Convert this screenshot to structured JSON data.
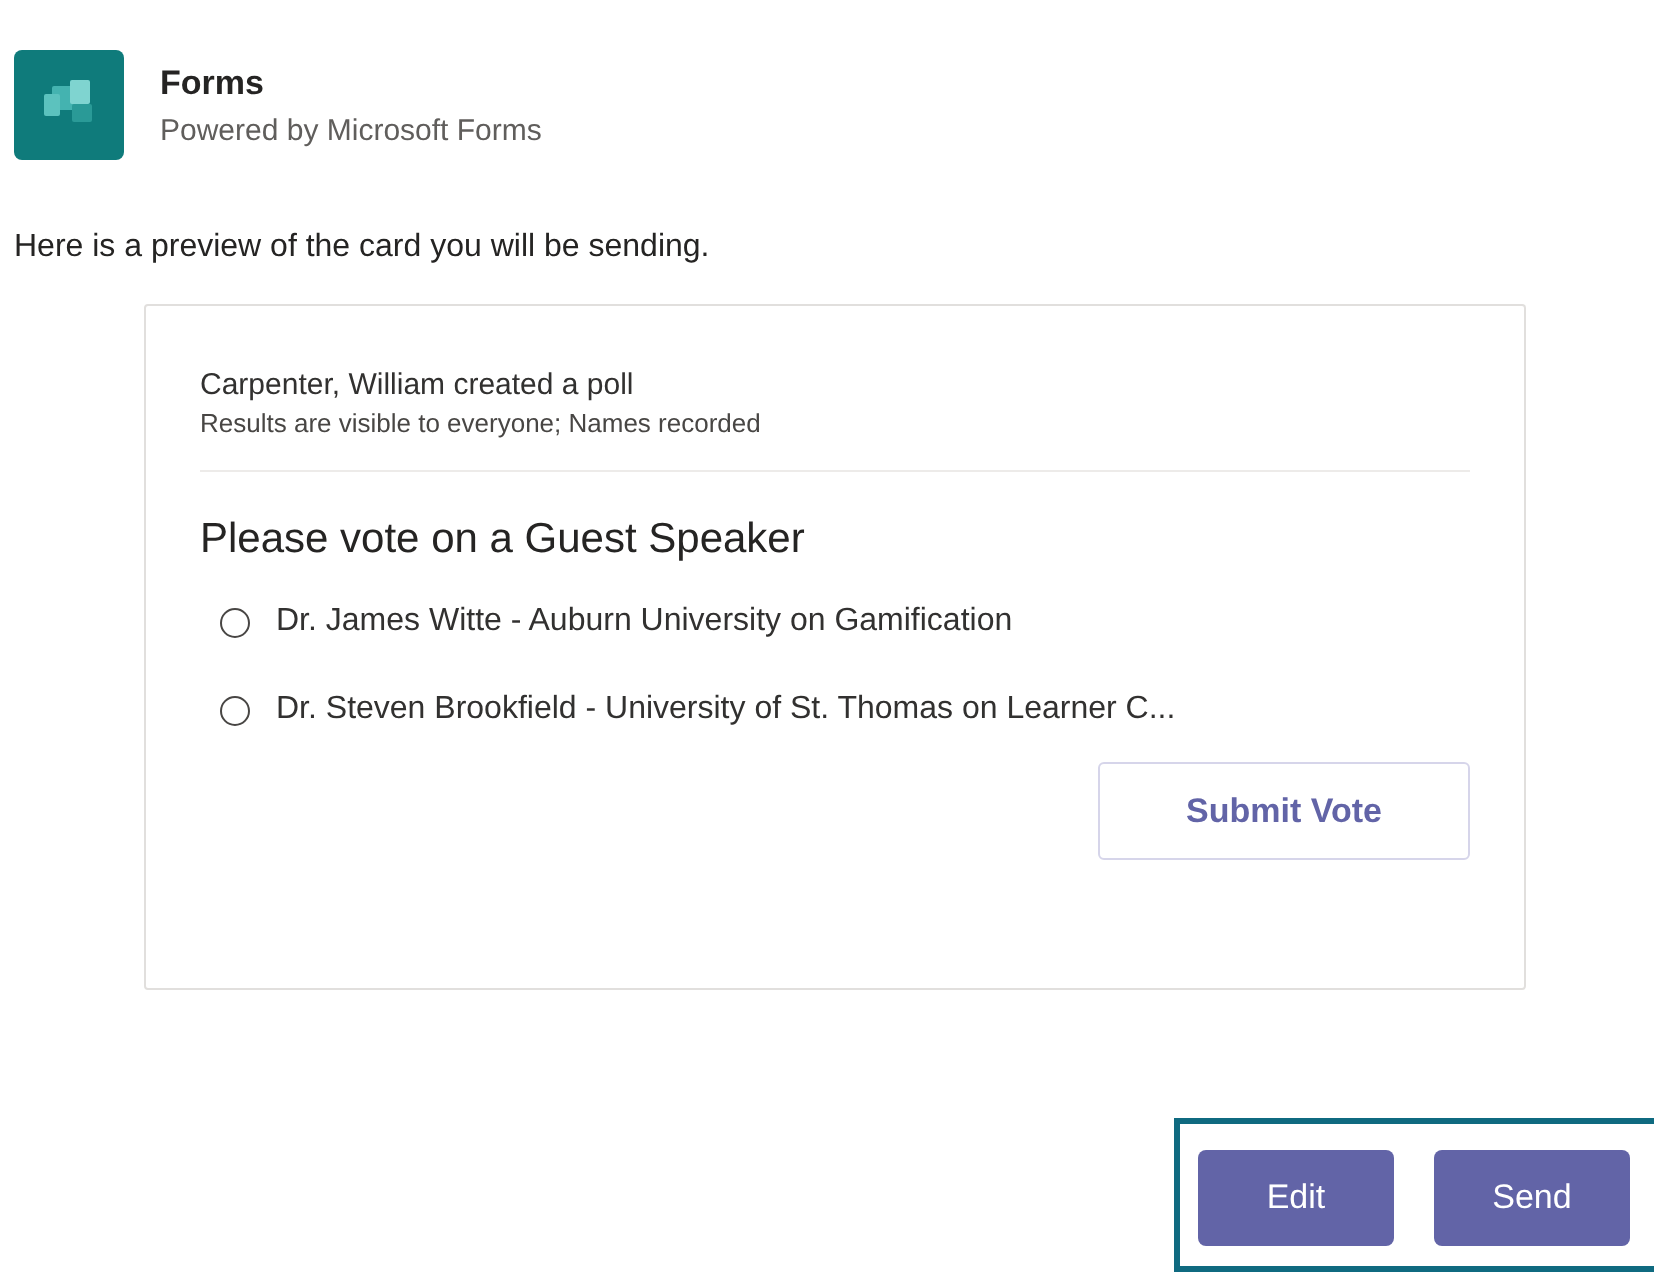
{
  "app": {
    "name": "Forms",
    "subtitle": "Powered by Microsoft Forms"
  },
  "intro": "Here is a preview of the card you will be sending.",
  "card": {
    "author_line": "Carpenter, William created a poll",
    "visibility": "Results are visible to everyone; Names recorded",
    "question": "Please vote on a Guest Speaker",
    "options": [
      {
        "label": "Dr. James Witte - Auburn University on Gamification",
        "selected": false
      },
      {
        "label": "Dr. Steven Brookfield - University of St. Thomas on Learner C...",
        "selected": false
      }
    ],
    "submit": "Submit Vote"
  },
  "buttons": [
    "Edit",
    "Send"
  ]
}
